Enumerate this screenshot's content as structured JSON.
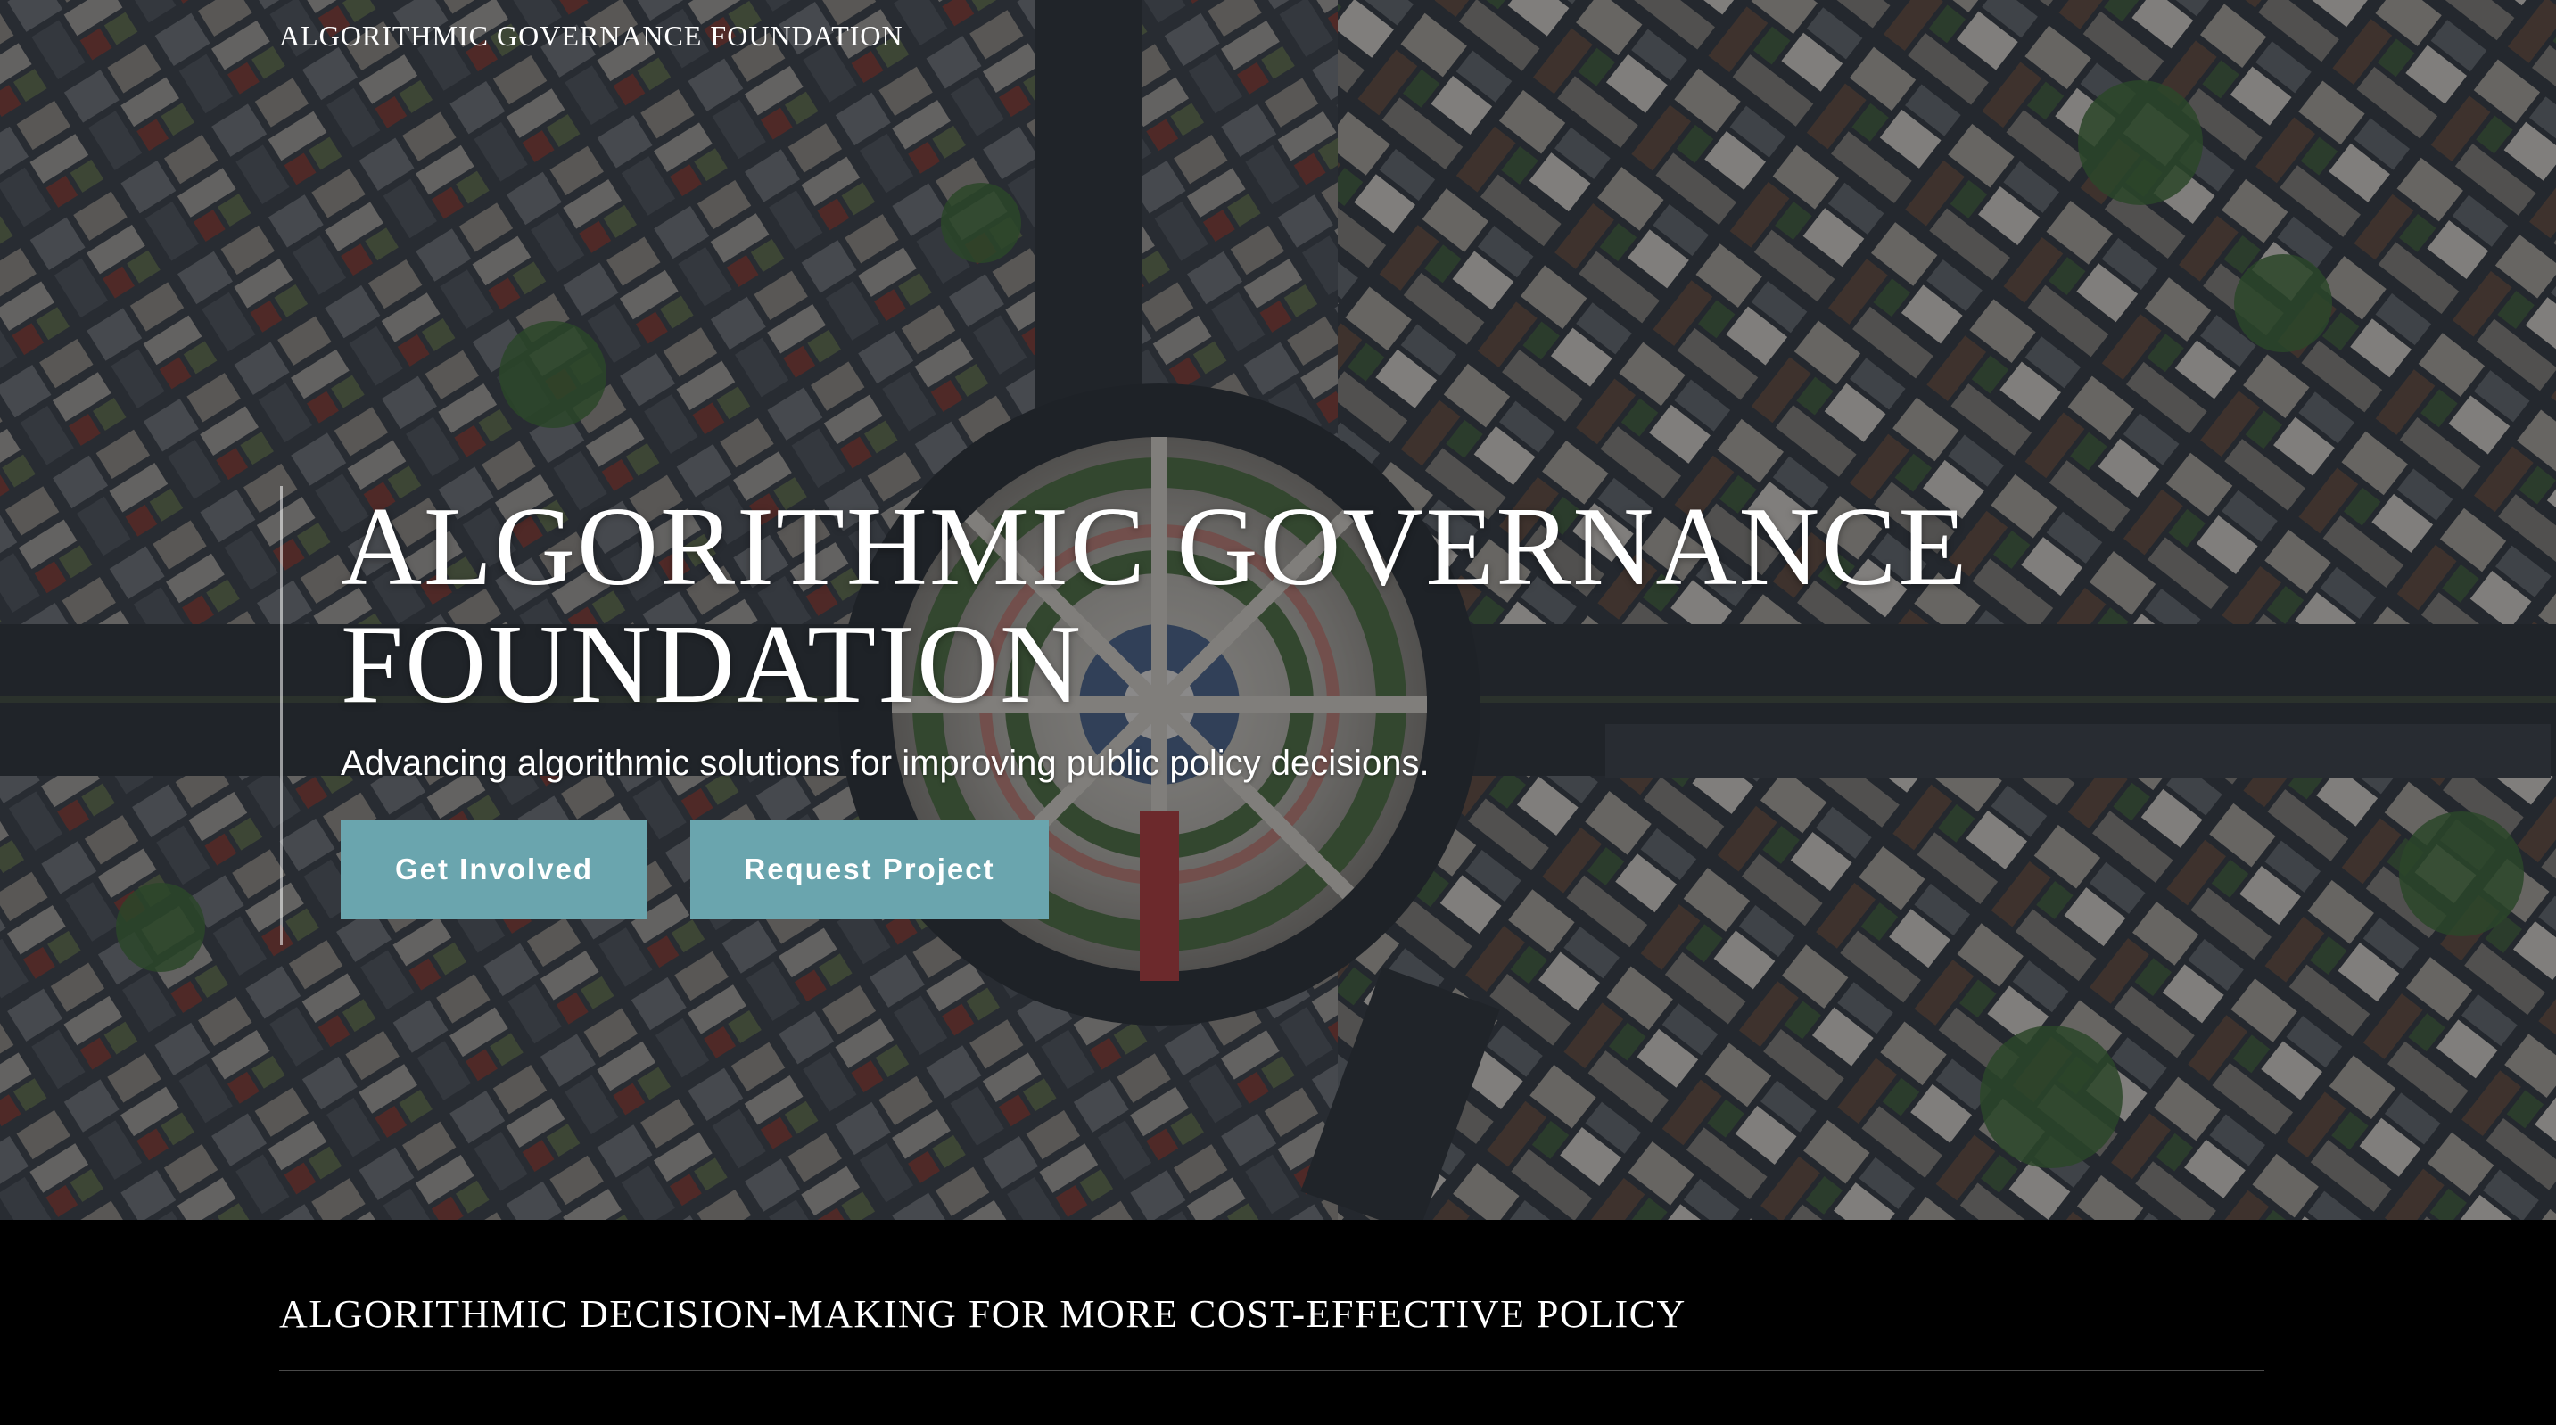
{
  "header": {
    "site_name": "ALGORITHMIC GOVERNANCE FOUNDATION"
  },
  "hero": {
    "title": "ALGORITHMIC GOVERNANCE FOUNDATION",
    "subtitle": "Advancing algorithmic solutions for improving public policy decisions.",
    "buttons": {
      "get_involved": "Get Involved",
      "request_project": "Request Project"
    },
    "background_image": "aerial-city-roundabout"
  },
  "section": {
    "heading": "ALGORITHMIC DECISION-MAKING FOR MORE COST-EFFECTIVE POLICY"
  },
  "colors": {
    "button_bg": "#6aa5ae",
    "dark_section_bg": "#000000",
    "text": "#ffffff"
  }
}
